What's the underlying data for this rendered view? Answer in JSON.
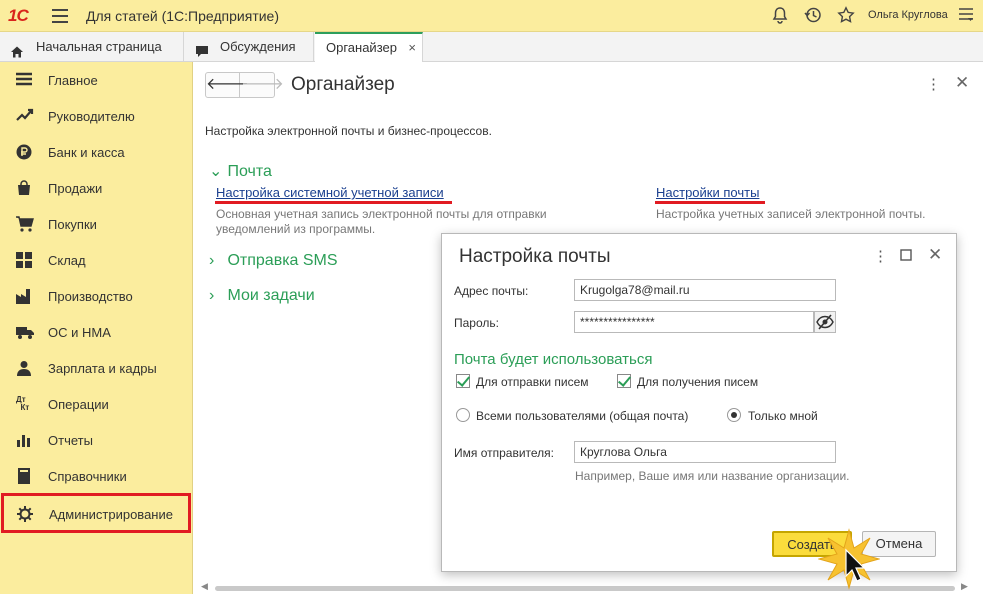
{
  "app": {
    "logo": "1С",
    "title": "Для статей  (1С:Предприятие)",
    "user": "Ольга Круглова"
  },
  "tabs": [
    {
      "label": "Начальная страница",
      "icon": "home-icon"
    },
    {
      "label": "Обсуждения",
      "icon": "chat-icon"
    },
    {
      "label": "Органайзер",
      "close": "×",
      "active": true
    }
  ],
  "sidebar": {
    "items": [
      {
        "label": "Главное",
        "icon": "list-icon"
      },
      {
        "label": "Руководителю",
        "icon": "trend-icon"
      },
      {
        "label": "Банк и касса",
        "icon": "ruble-icon"
      },
      {
        "label": "Продажи",
        "icon": "bag-icon"
      },
      {
        "label": "Покупки",
        "icon": "cart-icon"
      },
      {
        "label": "Склад",
        "icon": "grid-icon"
      },
      {
        "label": "Производство",
        "icon": "factory-icon"
      },
      {
        "label": "ОС и НМА",
        "icon": "truck-icon"
      },
      {
        "label": "Зарплата и кадры",
        "icon": "person-icon"
      },
      {
        "label": "Операции",
        "icon": "dt-kt-icon"
      },
      {
        "label": "Отчеты",
        "icon": "bar-chart-icon"
      },
      {
        "label": "Справочники",
        "icon": "book-icon"
      },
      {
        "label": "Администрирование",
        "icon": "gear-icon",
        "highlighted": true
      }
    ]
  },
  "main": {
    "title": "Органайзер",
    "description": "Настройка электронной почты и бизнес-процессов.",
    "groups": {
      "mail": "Почта",
      "sms": "Отправка SMS",
      "tasks": "Мои задачи"
    },
    "links": {
      "system_account": "Настройка системной учетной записи",
      "system_account_desc_1": "Основная учетная запись электронной почты для отправки",
      "system_account_desc_2": "уведомлений из программы.",
      "mail_settings": "Настройки почты",
      "mail_settings_desc": "Настройка учетных записей электронной почты."
    }
  },
  "dialog": {
    "title": "Настройка почты",
    "email_label": "Адрес почты:",
    "email_value": "Krugolga78@mail.ru",
    "password_label": "Пароль:",
    "password_value": "****************",
    "usage_title": "Почта будет использоваться",
    "send_label": "Для отправки писем",
    "receive_label": "Для получения писем",
    "all_users_label": "Всеми пользователями (общая почта)",
    "only_me_label": "Только мной",
    "sender_label": "Имя отправителя:",
    "sender_value": "Круглова Ольга",
    "sender_hint": "Например, Ваше имя или название организации.",
    "create_button": "Создать",
    "cancel_button": "Отмена"
  },
  "colors": {
    "accent_green": "#2b9e57",
    "highlight_red": "#e11b22",
    "panel_yellow": "#fbed9e",
    "button_yellow": "#fbdc3c"
  }
}
